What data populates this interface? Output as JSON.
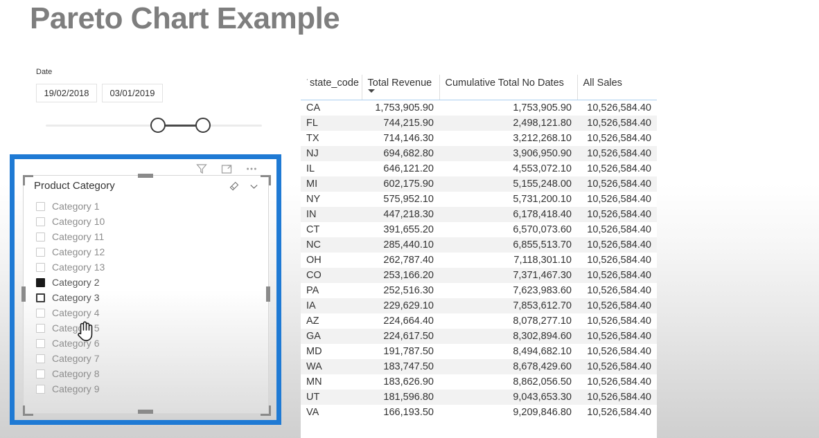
{
  "page": {
    "title": "Pareto Chart Example",
    "title_color": "#7e7e7e",
    "selection_color": "#1f7ad4"
  },
  "date_slicer": {
    "label": "Date",
    "start_date": "19/02/2018",
    "end_date": "03/01/2019"
  },
  "visual_toolbar": {
    "filter_icon": "filter-funnel-icon",
    "focus_icon": "focus-mode-icon",
    "more_icon": "more-options-icon"
  },
  "category_slicer": {
    "title": "Product Category",
    "clear_icon": "eraser-clear-selections-icon",
    "expand_icon": "chevron-down-icon",
    "items": [
      {
        "label": "Category 1",
        "checked": false,
        "focused": false
      },
      {
        "label": "Category 10",
        "checked": false,
        "focused": false
      },
      {
        "label": "Category 11",
        "checked": false,
        "focused": false
      },
      {
        "label": "Category 12",
        "checked": false,
        "focused": false
      },
      {
        "label": "Category 13",
        "checked": false,
        "focused": false
      },
      {
        "label": "Category 2",
        "checked": true,
        "focused": false
      },
      {
        "label": "Category 3",
        "checked": false,
        "focused": true
      },
      {
        "label": "Category 4",
        "checked": false,
        "focused": false
      },
      {
        "label": "Category 5",
        "checked": false,
        "focused": false
      },
      {
        "label": "Category 6",
        "checked": false,
        "focused": false
      },
      {
        "label": "Category 7",
        "checked": false,
        "focused": false
      },
      {
        "label": "Category 8",
        "checked": false,
        "focused": false
      },
      {
        "label": "Category 9",
        "checked": false,
        "focused": false
      }
    ]
  },
  "table": {
    "columns": [
      {
        "label": "state_code",
        "sorted": true,
        "prefix": "˙"
      },
      {
        "label": "Total Revenue",
        "sorted": false
      },
      {
        "label": "Cumulative Total No Dates",
        "sorted": false
      },
      {
        "label": "All Sales",
        "sorted": false
      }
    ],
    "rows": [
      {
        "state_code": "CA",
        "total_revenue": "1,753,905.90",
        "cumulative_total_no_dates": "1,753,905.90",
        "all_sales": "10,526,584.40"
      },
      {
        "state_code": "FL",
        "total_revenue": "744,215.90",
        "cumulative_total_no_dates": "2,498,121.80",
        "all_sales": "10,526,584.40"
      },
      {
        "state_code": "TX",
        "total_revenue": "714,146.30",
        "cumulative_total_no_dates": "3,212,268.10",
        "all_sales": "10,526,584.40"
      },
      {
        "state_code": "NJ",
        "total_revenue": "694,682.80",
        "cumulative_total_no_dates": "3,906,950.90",
        "all_sales": "10,526,584.40"
      },
      {
        "state_code": "IL",
        "total_revenue": "646,121.20",
        "cumulative_total_no_dates": "4,553,072.10",
        "all_sales": "10,526,584.40"
      },
      {
        "state_code": "MI",
        "total_revenue": "602,175.90",
        "cumulative_total_no_dates": "5,155,248.00",
        "all_sales": "10,526,584.40"
      },
      {
        "state_code": "NY",
        "total_revenue": "575,952.10",
        "cumulative_total_no_dates": "5,731,200.10",
        "all_sales": "10,526,584.40"
      },
      {
        "state_code": "IN",
        "total_revenue": "447,218.30",
        "cumulative_total_no_dates": "6,178,418.40",
        "all_sales": "10,526,584.40"
      },
      {
        "state_code": "CT",
        "total_revenue": "391,655.20",
        "cumulative_total_no_dates": "6,570,073.60",
        "all_sales": "10,526,584.40"
      },
      {
        "state_code": "NC",
        "total_revenue": "285,440.10",
        "cumulative_total_no_dates": "6,855,513.70",
        "all_sales": "10,526,584.40"
      },
      {
        "state_code": "OH",
        "total_revenue": "262,787.40",
        "cumulative_total_no_dates": "7,118,301.10",
        "all_sales": "10,526,584.40"
      },
      {
        "state_code": "CO",
        "total_revenue": "253,166.20",
        "cumulative_total_no_dates": "7,371,467.30",
        "all_sales": "10,526,584.40"
      },
      {
        "state_code": "PA",
        "total_revenue": "252,516.30",
        "cumulative_total_no_dates": "7,623,983.60",
        "all_sales": "10,526,584.40"
      },
      {
        "state_code": "IA",
        "total_revenue": "229,629.10",
        "cumulative_total_no_dates": "7,853,612.70",
        "all_sales": "10,526,584.40"
      },
      {
        "state_code": "AZ",
        "total_revenue": "224,664.40",
        "cumulative_total_no_dates": "8,078,277.10",
        "all_sales": "10,526,584.40"
      },
      {
        "state_code": "GA",
        "total_revenue": "224,617.50",
        "cumulative_total_no_dates": "8,302,894.60",
        "all_sales": "10,526,584.40"
      },
      {
        "state_code": "MD",
        "total_revenue": "191,787.50",
        "cumulative_total_no_dates": "8,494,682.10",
        "all_sales": "10,526,584.40"
      },
      {
        "state_code": "WA",
        "total_revenue": "183,747.50",
        "cumulative_total_no_dates": "8,678,429.60",
        "all_sales": "10,526,584.40"
      },
      {
        "state_code": "MN",
        "total_revenue": "183,626.90",
        "cumulative_total_no_dates": "8,862,056.50",
        "all_sales": "10,526,584.40"
      },
      {
        "state_code": "UT",
        "total_revenue": "181,596.80",
        "cumulative_total_no_dates": "9,043,653.30",
        "all_sales": "10,526,584.40"
      },
      {
        "state_code": "VA",
        "total_revenue": "166,193.50",
        "cumulative_total_no_dates": "9,209,846.80",
        "all_sales": "10,526,584.40"
      }
    ]
  },
  "chart_data": {
    "type": "table",
    "title": "Pareto Chart Example",
    "categories": [
      "CA",
      "FL",
      "TX",
      "NJ",
      "IL",
      "MI",
      "NY",
      "IN",
      "CT",
      "NC",
      "OH",
      "CO",
      "PA",
      "IA",
      "AZ",
      "GA",
      "MD",
      "WA",
      "MN",
      "UT",
      "VA"
    ],
    "series": [
      {
        "name": "Total Revenue",
        "values": [
          1753905.9,
          744215.9,
          714146.3,
          694682.8,
          646121.2,
          602175.9,
          575952.1,
          447218.3,
          391655.2,
          285440.1,
          262787.4,
          253166.2,
          252516.3,
          229629.1,
          224664.4,
          224617.5,
          191787.5,
          183747.5,
          183626.9,
          181596.8,
          166193.5
        ]
      },
      {
        "name": "Cumulative Total No Dates",
        "values": [
          1753905.9,
          2498121.8,
          3212268.1,
          3906950.9,
          4553072.1,
          5155248.0,
          5731200.1,
          6178418.4,
          6570073.6,
          6855513.7,
          7118301.1,
          7371467.3,
          7623983.6,
          7853612.7,
          8078277.1,
          8302894.6,
          8494682.1,
          8678429.6,
          8862056.5,
          9043653.3,
          9209846.8
        ]
      },
      {
        "name": "All Sales",
        "values": [
          10526584.4,
          10526584.4,
          10526584.4,
          10526584.4,
          10526584.4,
          10526584.4,
          10526584.4,
          10526584.4,
          10526584.4,
          10526584.4,
          10526584.4,
          10526584.4,
          10526584.4,
          10526584.4,
          10526584.4,
          10526584.4,
          10526584.4,
          10526584.4,
          10526584.4,
          10526584.4,
          10526584.4
        ]
      }
    ],
    "xlabel": "state_code",
    "ylabel": "",
    "legend": [
      "Total Revenue",
      "Cumulative Total No Dates",
      "All Sales"
    ],
    "grid": false
  }
}
